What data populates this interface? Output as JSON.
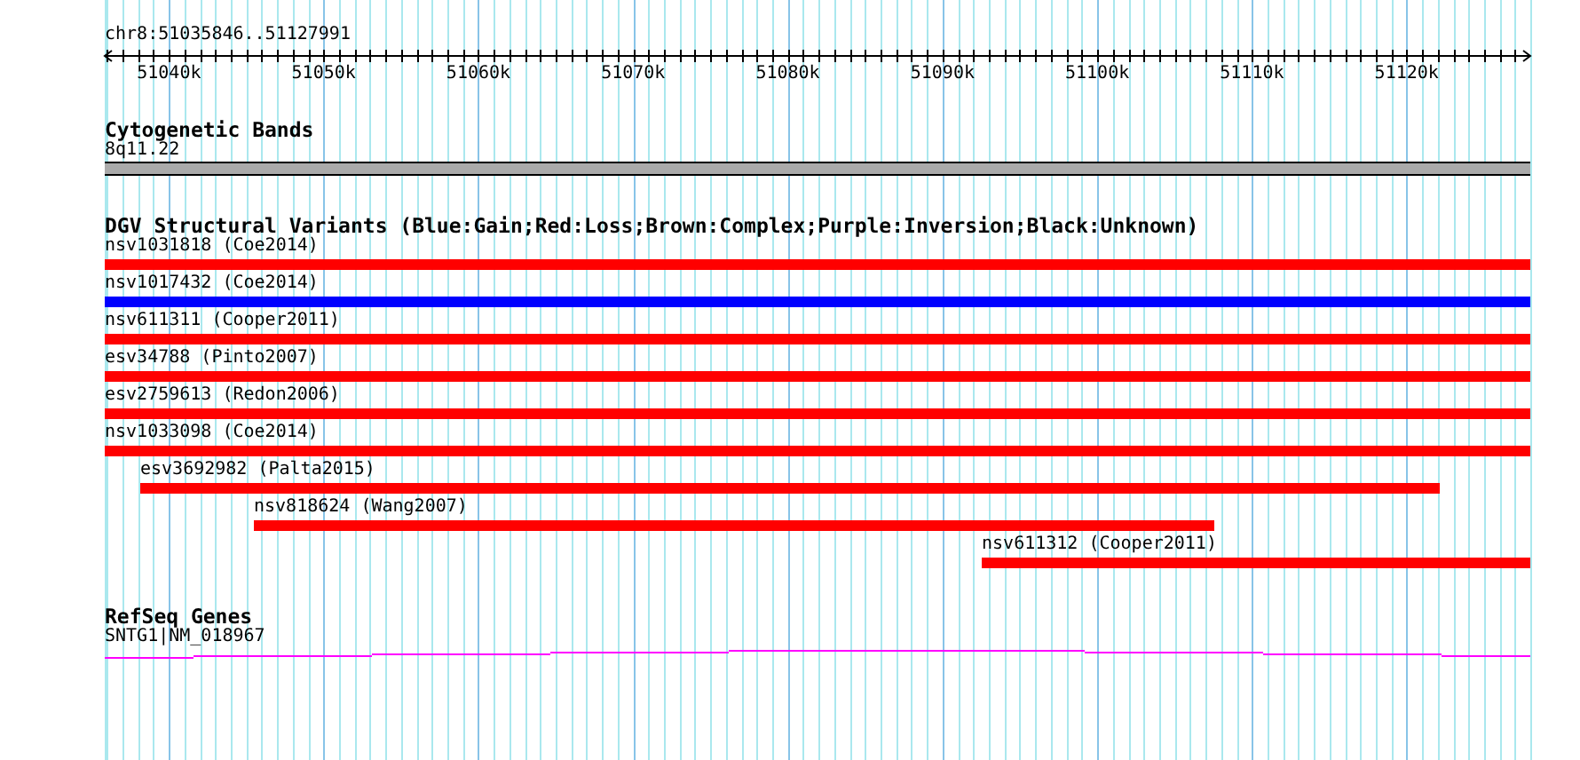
{
  "region": {
    "label": "chr8:51035846..51127991"
  },
  "ticks": [
    {
      "label": "51040k"
    },
    {
      "label": "51050k"
    },
    {
      "label": "51060k"
    },
    {
      "label": "51070k"
    },
    {
      "label": "51080k"
    },
    {
      "label": "51090k"
    },
    {
      "label": "51100k"
    },
    {
      "label": "51110k"
    },
    {
      "label": "51120k"
    }
  ],
  "tracks": [
    {
      "kind": "bands",
      "title": "Cytogenetic Bands",
      "features": [
        {
          "label": "8q11.22",
          "color": "#aaaaaa"
        }
      ]
    },
    {
      "kind": "variants",
      "title": "DGV Structural Variants (Blue:Gain;Red:Loss;Brown:Complex;Purple:Inversion;Black:Unknown)",
      "features": [
        {
          "label": "nsv1031818 (Coe2014)",
          "color": "#ff0000"
        },
        {
          "label": "nsv1017432 (Coe2014)",
          "color": "#0000ff"
        },
        {
          "label": "nsv611311 (Cooper2011)",
          "color": "#ff0000"
        },
        {
          "label": "esv34788 (Pinto2007)",
          "color": "#ff0000"
        },
        {
          "label": "esv2759613 (Redon2006)",
          "color": "#ff0000"
        },
        {
          "label": "nsv1033098 (Coe2014)",
          "color": "#ff0000"
        },
        {
          "label": "esv3692982 (Palta2015)",
          "color": "#ff0000"
        },
        {
          "label": "nsv818624 (Wang2007)",
          "color": "#ff0000"
        },
        {
          "label": "nsv611312 (Cooper2011)",
          "color": "#ff0000"
        }
      ]
    },
    {
      "kind": "gene",
      "title": "RefSeq Genes",
      "features": [
        {
          "label": "SNTG1|NM_018967",
          "color": "#ff00ff"
        }
      ]
    }
  ]
}
